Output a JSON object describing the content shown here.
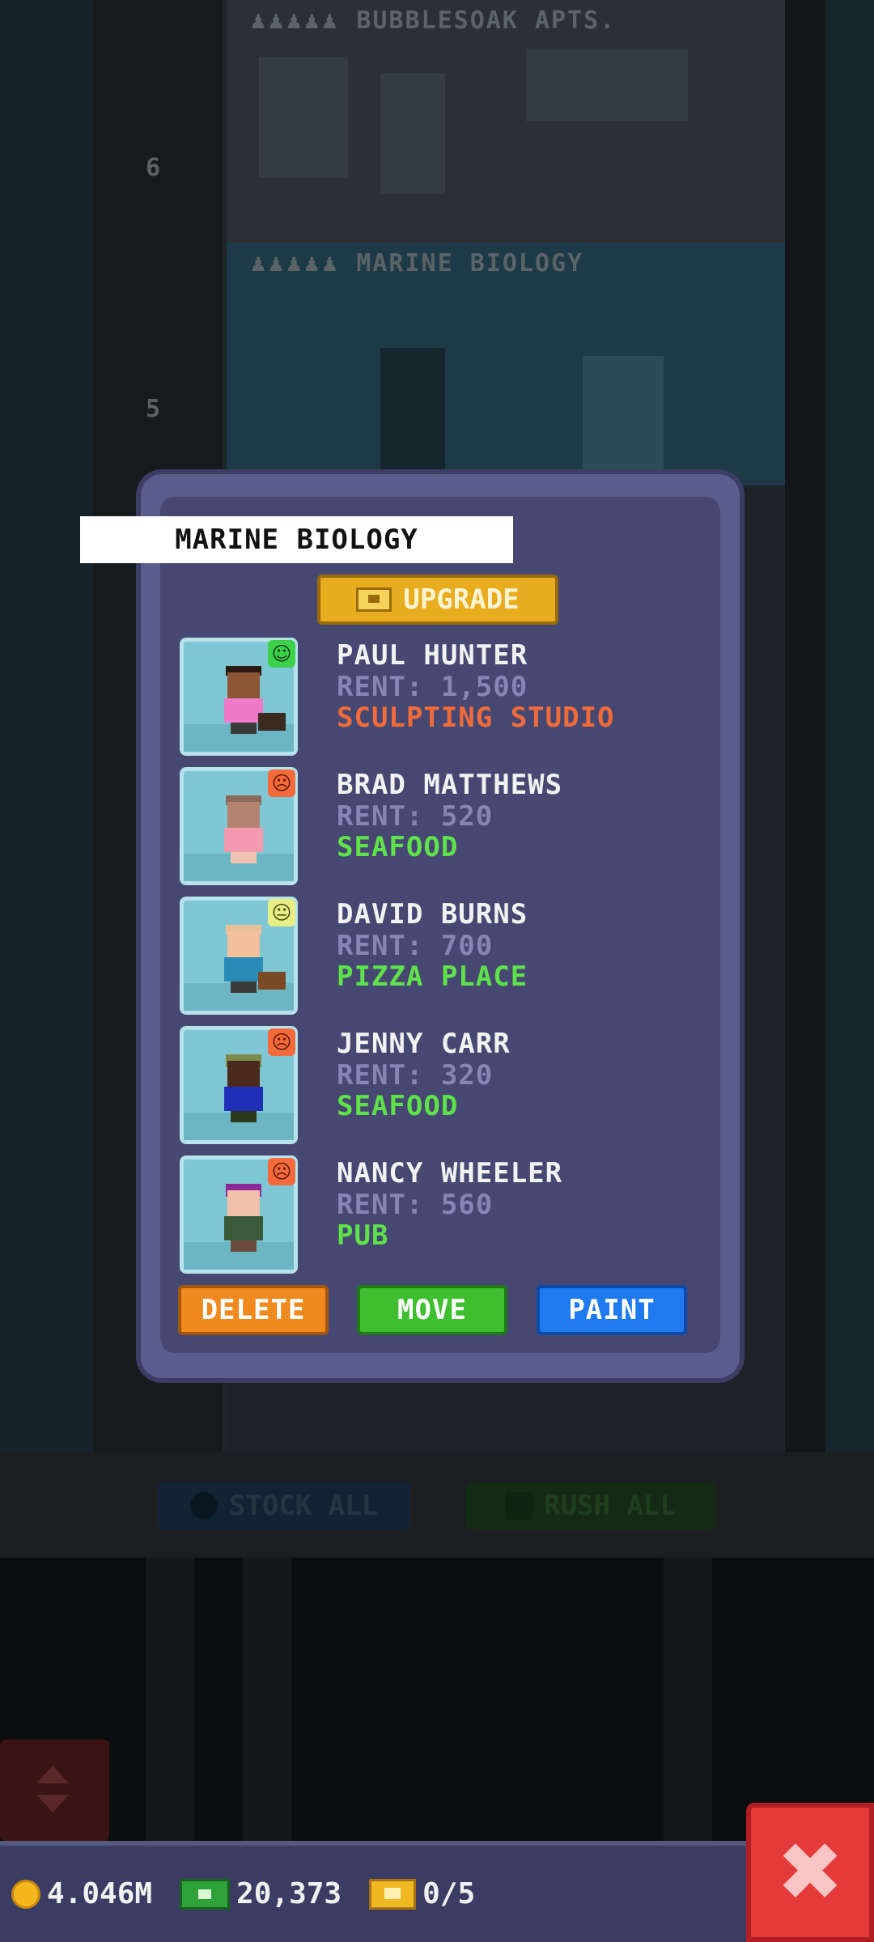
{
  "background": {
    "floor_apts_sign": "BUBBLESOAK APTS.",
    "floor_marine_sign": "MARINE BIOLOGY",
    "floor_numbers": [
      "6",
      "5"
    ],
    "stock_all_label": "STOCK ALL",
    "rush_all_label": "RUSH ALL"
  },
  "dialog": {
    "title": "MARINE BIOLOGY",
    "upgrade_label": "UPGRADE",
    "residents": [
      {
        "name": "PAUL HUNTER",
        "rent": "RENT: 1,500",
        "job": "SCULPTING STUDIO",
        "job_color": "#f06b3a",
        "mood": "happy",
        "mood_icon": "happy-face-icon"
      },
      {
        "name": "BRAD MATTHEWS",
        "rent": "RENT: 520",
        "job": "SEAFOOD",
        "job_color": "#5fe14a",
        "mood": "sad",
        "mood_icon": "sad-face-icon"
      },
      {
        "name": "DAVID BURNS",
        "rent": "RENT: 700",
        "job": "PIZZA PLACE",
        "job_color": "#5fe14a",
        "mood": "neutral",
        "mood_icon": "neutral-face-icon"
      },
      {
        "name": "JENNY CARR",
        "rent": "RENT: 320",
        "job": "SEAFOOD",
        "job_color": "#5fe14a",
        "mood": "sad",
        "mood_icon": "sad-face-icon"
      },
      {
        "name": "NANCY WHEELER",
        "rent": "RENT: 560",
        "job": "PUB",
        "job_color": "#5fe14a",
        "mood": "sad",
        "mood_icon": "sad-face-icon"
      }
    ],
    "delete_label": "DELETE",
    "move_label": "MOVE",
    "paint_label": "PAINT"
  },
  "status": {
    "coins": "4.046M",
    "bux_cash": "20,373",
    "vip": "0/5"
  },
  "colors": {
    "delete": "#f08a1e",
    "move": "#3fbf2f",
    "paint": "#1f7af0",
    "close": "#e53a3a"
  }
}
